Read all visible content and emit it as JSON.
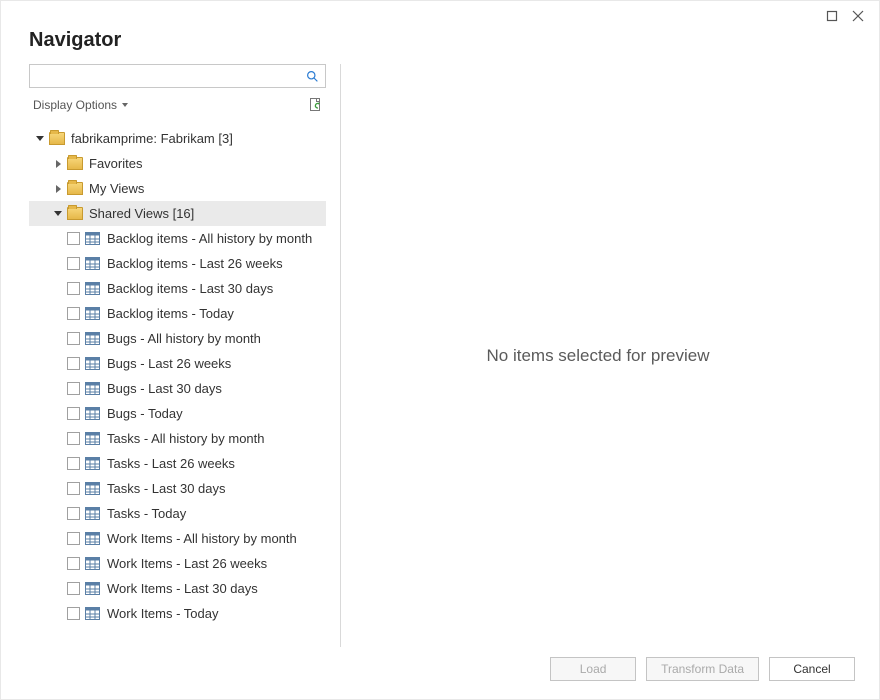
{
  "title": "Navigator",
  "display_options_label": "Display Options",
  "search": {
    "placeholder": ""
  },
  "preview_empty": "No items selected for preview",
  "tree": {
    "root": {
      "label": "fabrikamprime: Fabrikam [3]"
    },
    "favorites": {
      "label": "Favorites"
    },
    "myviews": {
      "label": "My Views"
    },
    "shared": {
      "label": "Shared Views [16]",
      "items": [
        {
          "label": "Backlog items - All history by month"
        },
        {
          "label": "Backlog items - Last 26 weeks"
        },
        {
          "label": "Backlog items - Last 30 days"
        },
        {
          "label": "Backlog items - Today"
        },
        {
          "label": "Bugs - All history by month"
        },
        {
          "label": "Bugs - Last 26 weeks"
        },
        {
          "label": "Bugs - Last 30 days"
        },
        {
          "label": "Bugs - Today"
        },
        {
          "label": "Tasks - All history by month"
        },
        {
          "label": "Tasks - Last 26 weeks"
        },
        {
          "label": "Tasks - Last 30 days"
        },
        {
          "label": "Tasks - Today"
        },
        {
          "label": "Work Items - All history by month"
        },
        {
          "label": "Work Items - Last 26 weeks"
        },
        {
          "label": "Work Items - Last 30 days"
        },
        {
          "label": "Work Items - Today"
        }
      ]
    }
  },
  "buttons": {
    "load": "Load",
    "transform": "Transform Data",
    "cancel": "Cancel"
  }
}
